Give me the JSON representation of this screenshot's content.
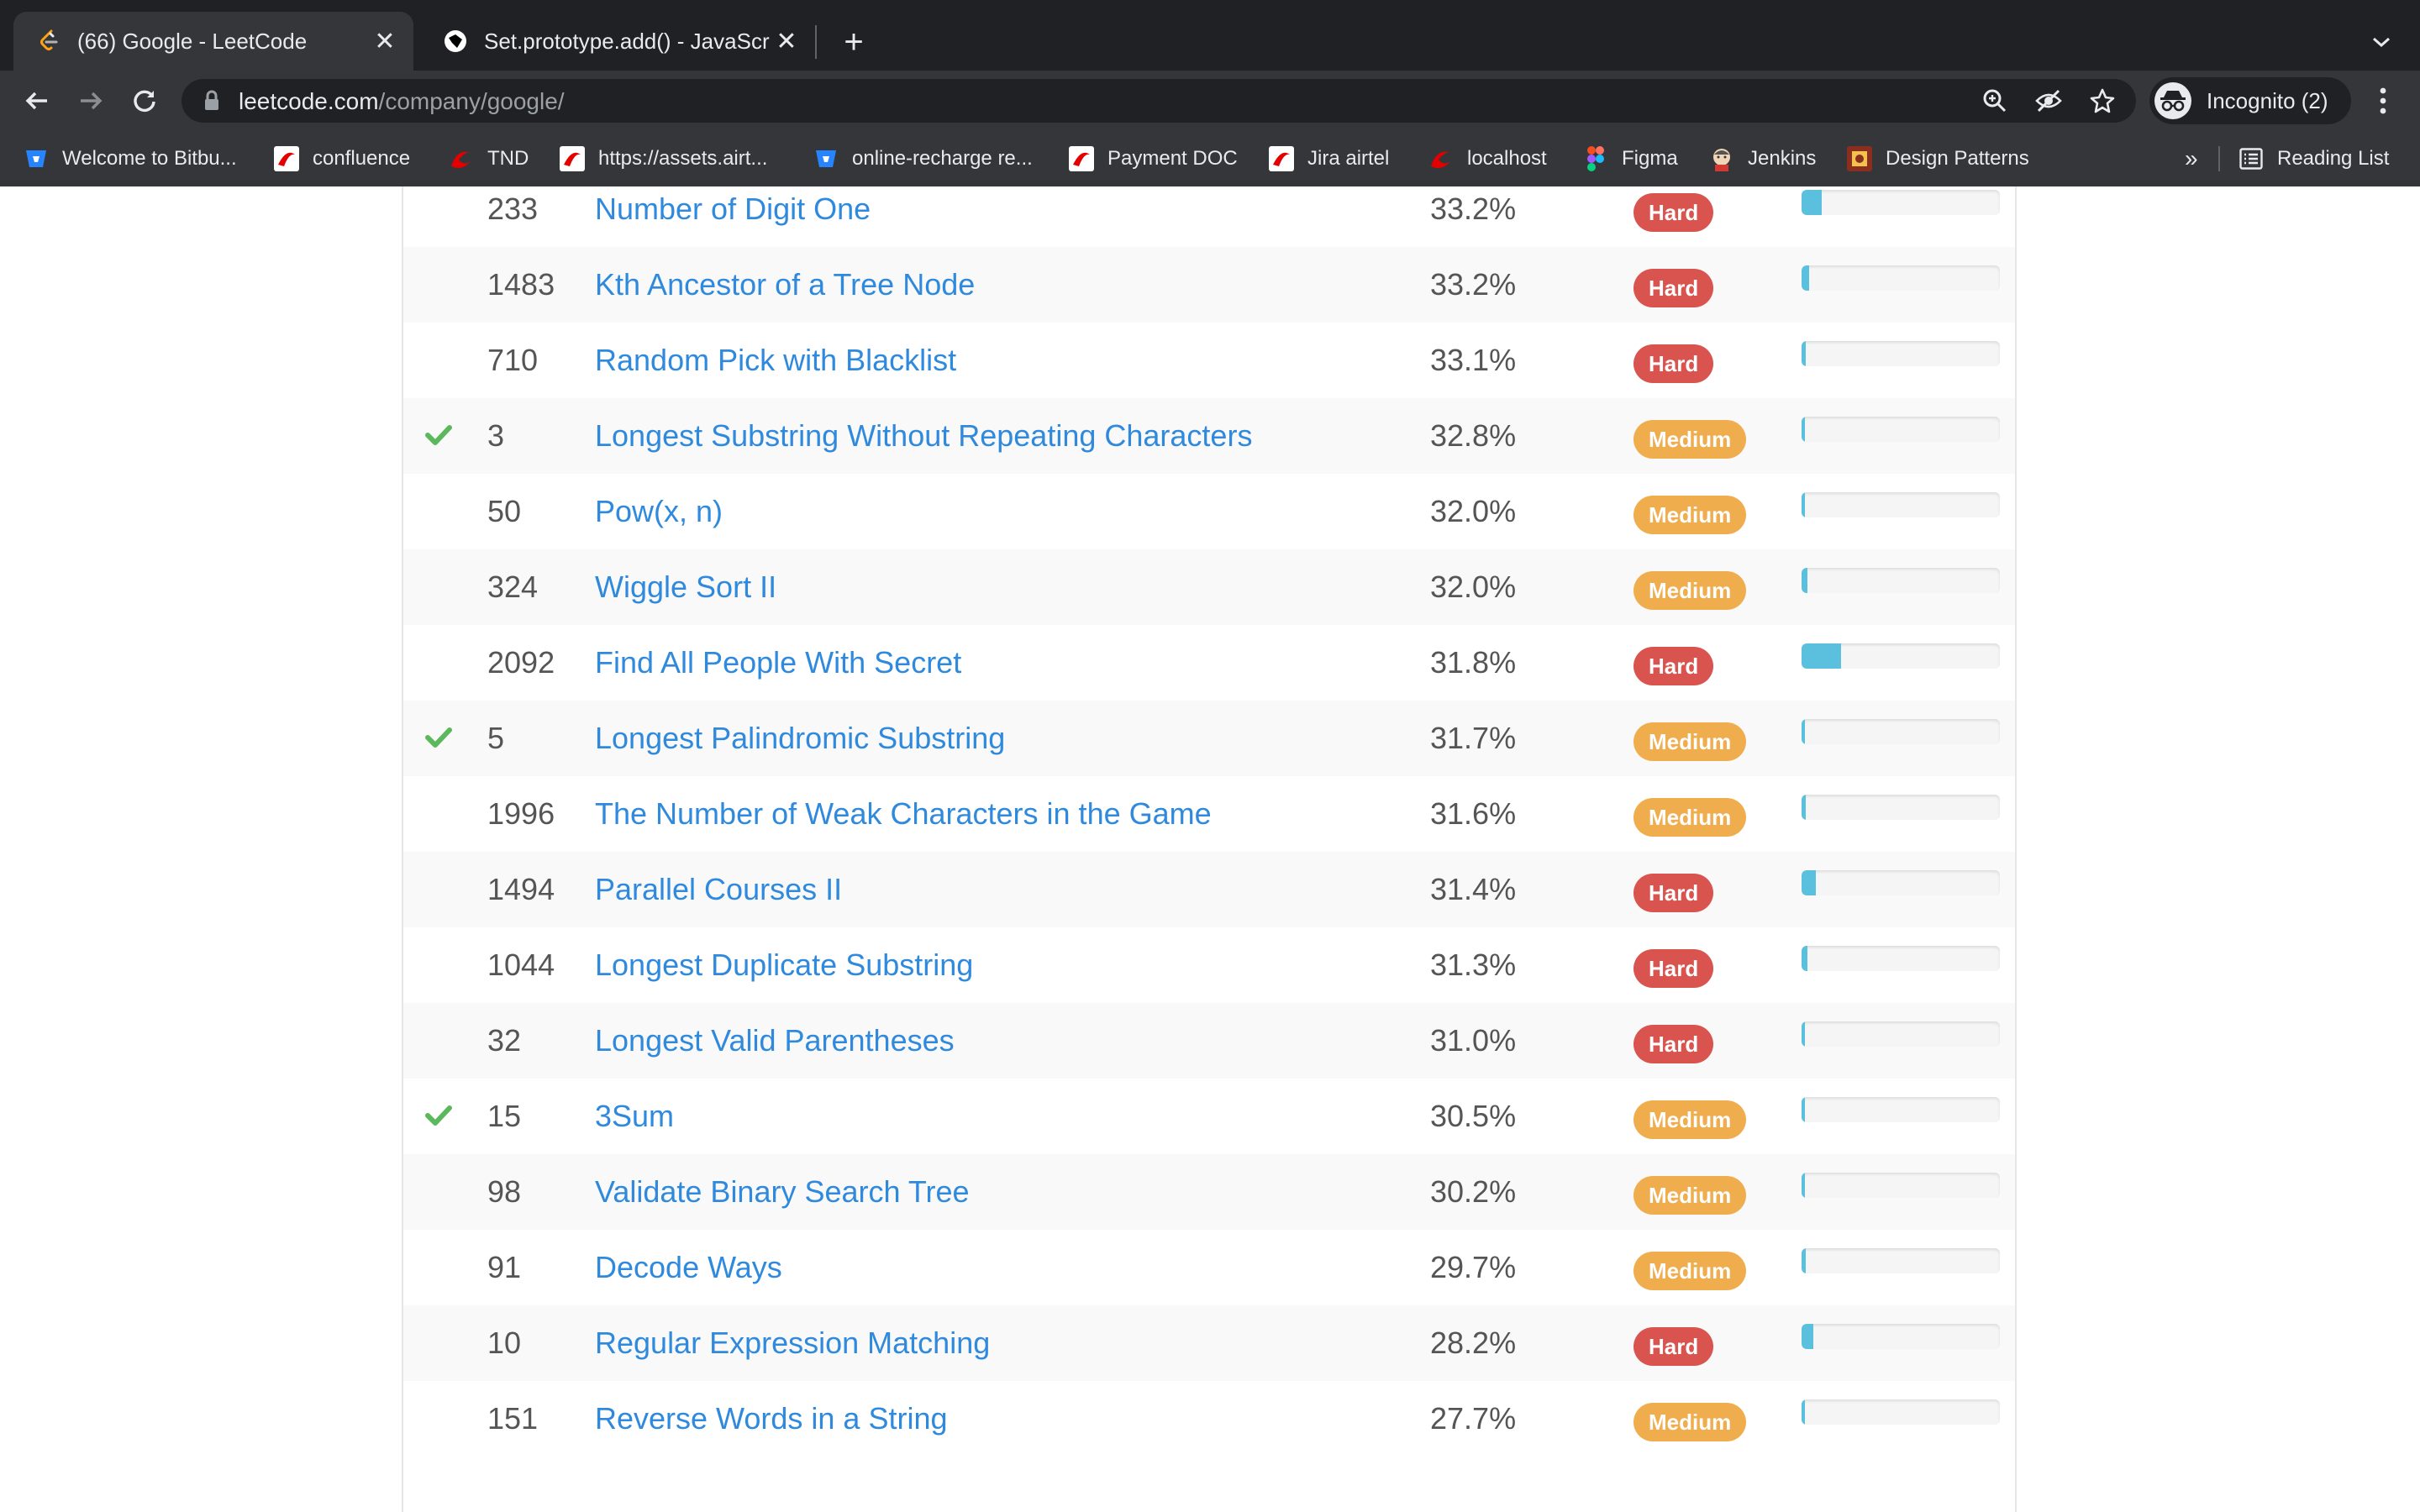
{
  "browser": {
    "tabs": [
      {
        "title": "(66) Google - LeetCode",
        "active": true,
        "icon": "leetcode-icon"
      },
      {
        "title": "Set.prototype.add() - JavaScript",
        "active": false,
        "icon": "mdn-icon"
      }
    ],
    "url": {
      "host": "leetcode.com",
      "path": "/company/google/"
    },
    "profile_label": "Incognito (2)",
    "bookmarks": [
      {
        "label": "Welcome to Bitbu...",
        "icon": "bitbucket-icon"
      },
      {
        "label": "confluence",
        "icon": "airtel-icon"
      },
      {
        "label": "TND",
        "icon": "airtel-red-icon"
      },
      {
        "label": "https://assets.airt...",
        "icon": "airtel-icon"
      },
      {
        "label": "online-recharge re...",
        "icon": "bitbucket-icon"
      },
      {
        "label": "Payment DOC",
        "icon": "airtel-icon"
      },
      {
        "label": "Jira airtel",
        "icon": "airtel-icon"
      },
      {
        "label": "localhost",
        "icon": "airtel-red-icon"
      },
      {
        "label": "Figma",
        "icon": "figma-icon"
      },
      {
        "label": "Jenkins",
        "icon": "jenkins-icon"
      },
      {
        "label": "Design Patterns",
        "icon": "design-patterns-icon"
      }
    ],
    "bookmarks_more": "»",
    "reading_list_label": "Reading List"
  },
  "problems": [
    {
      "solved": false,
      "id": "233",
      "title": "Number of Digit One",
      "acceptance": "33.2%",
      "difficulty": "Hard",
      "frequency": 0.1
    },
    {
      "solved": false,
      "id": "1483",
      "title": "Kth Ancestor of a Tree Node",
      "acceptance": "33.2%",
      "difficulty": "Hard",
      "frequency": 0.04
    },
    {
      "solved": false,
      "id": "710",
      "title": "Random Pick with Blacklist",
      "acceptance": "33.1%",
      "difficulty": "Hard",
      "frequency": 0.02
    },
    {
      "solved": true,
      "id": "3",
      "title": "Longest Substring Without Repeating Characters",
      "acceptance": "32.8%",
      "difficulty": "Medium",
      "frequency": 0.01
    },
    {
      "solved": false,
      "id": "50",
      "title": "Pow(x, n)",
      "acceptance": "32.0%",
      "difficulty": "Medium",
      "frequency": 0.01
    },
    {
      "solved": false,
      "id": "324",
      "title": "Wiggle Sort II",
      "acceptance": "32.0%",
      "difficulty": "Medium",
      "frequency": 0.03
    },
    {
      "solved": false,
      "id": "2092",
      "title": "Find All People With Secret",
      "acceptance": "31.8%",
      "difficulty": "Hard",
      "frequency": 0.2
    },
    {
      "solved": true,
      "id": "5",
      "title": "Longest Palindromic Substring",
      "acceptance": "31.7%",
      "difficulty": "Medium",
      "frequency": 0.0
    },
    {
      "solved": false,
      "id": "1996",
      "title": "The Number of Weak Characters in the Game",
      "acceptance": "31.6%",
      "difficulty": "Medium",
      "frequency": 0.02
    },
    {
      "solved": false,
      "id": "1494",
      "title": "Parallel Courses II",
      "acceptance": "31.4%",
      "difficulty": "Hard",
      "frequency": 0.07
    },
    {
      "solved": false,
      "id": "1044",
      "title": "Longest Duplicate Substring",
      "acceptance": "31.3%",
      "difficulty": "Hard",
      "frequency": 0.03
    },
    {
      "solved": false,
      "id": "32",
      "title": "Longest Valid Parentheses",
      "acceptance": "31.0%",
      "difficulty": "Hard",
      "frequency": 0.0
    },
    {
      "solved": true,
      "id": "15",
      "title": "3Sum",
      "acceptance": "30.5%",
      "difficulty": "Medium",
      "frequency": 0.0
    },
    {
      "solved": false,
      "id": "98",
      "title": "Validate Binary Search Tree",
      "acceptance": "30.2%",
      "difficulty": "Medium",
      "frequency": 0.0
    },
    {
      "solved": false,
      "id": "91",
      "title": "Decode Ways",
      "acceptance": "29.7%",
      "difficulty": "Medium",
      "frequency": 0.02
    },
    {
      "solved": false,
      "id": "10",
      "title": "Regular Expression Matching",
      "acceptance": "28.2%",
      "difficulty": "Hard",
      "frequency": 0.06
    },
    {
      "solved": false,
      "id": "151",
      "title": "Reverse Words in a String",
      "acceptance": "27.7%",
      "difficulty": "Medium",
      "frequency": 0.0
    }
  ],
  "colors": {
    "link": "#2f89dc",
    "hard": "#d9534f",
    "medium": "#f0ad4e",
    "check": "#5cb85c",
    "freq_fill": "#5bc0de"
  }
}
